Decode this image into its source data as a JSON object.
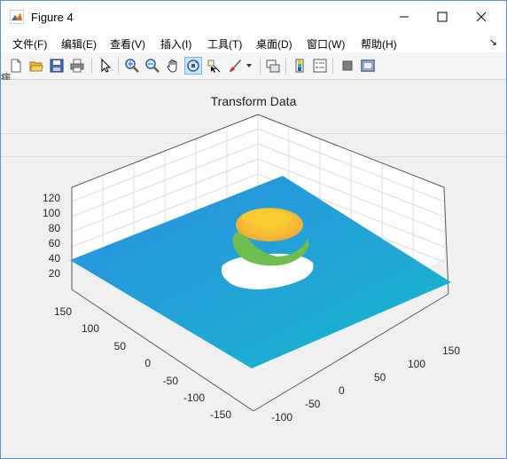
{
  "window": {
    "title": "Figure 4"
  },
  "menu": [
    "文件(F)",
    "编辑(E)",
    "查看(V)",
    "插入(I)",
    "工具(T)",
    "桌面(D)",
    "窗口(W)",
    "帮助(H)"
  ],
  "toolbar": {
    "icons": [
      "new-figure-icon",
      "open-file-icon",
      "save-icon",
      "print-icon",
      "select-arrow-icon",
      "zoom-in-icon",
      "zoom-out-icon",
      "pan-hand-icon",
      "rotate-3d-icon",
      "data-cursor-icon",
      "brush-icon",
      "brush-dropdown-icon",
      "link-plot-icon",
      "colorbar-icon",
      "legend-icon",
      "hide-plot-tools-icon",
      "show-plot-tools-icon"
    ],
    "active": "rotate-3d-icon"
  },
  "left_partial_text": "病",
  "plot": {
    "title": "Transform Data",
    "z_ticks": [
      "20",
      "40",
      "60",
      "80",
      "100",
      "120"
    ],
    "y_ticks": [
      "150",
      "100",
      "50",
      "0",
      "-50",
      "-100",
      "-150"
    ],
    "x_ticks": [
      "-100",
      "-50",
      "0",
      "50",
      "100",
      "150"
    ]
  },
  "colors": {
    "surface": "#2b9fdc",
    "surface_edge": "#18b3d0",
    "blob_top": "#f7c531",
    "blob_ring": "#7dbd4a"
  }
}
